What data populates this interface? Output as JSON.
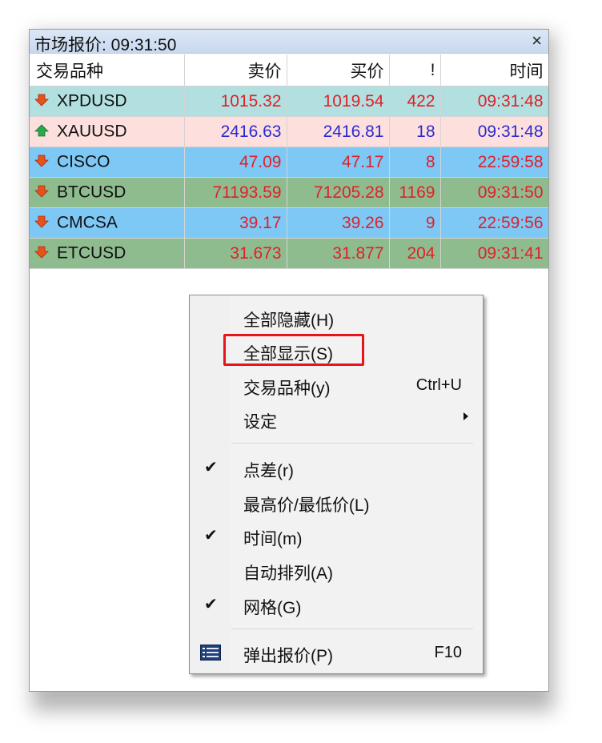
{
  "window": {
    "title": "市场报价: 09:31:50",
    "close_glyph": "×"
  },
  "table": {
    "headers": [
      "交易品种",
      "卖价",
      "买价",
      "!",
      "时间"
    ],
    "rows": [
      {
        "symbol": "XPDUSD",
        "bid": "1015.32",
        "ask": "1019.54",
        "spread": "422",
        "time": "09:31:48",
        "direction": "down",
        "row_color": "#b2dfdf",
        "value_color": "red"
      },
      {
        "symbol": "XAUUSD",
        "bid": "2416.63",
        "ask": "2416.81",
        "spread": "18",
        "time": "09:31:48",
        "direction": "up",
        "row_color": "#fde0de",
        "value_color": "blue"
      },
      {
        "symbol": "CISCO",
        "bid": "47.09",
        "ask": "47.17",
        "spread": "8",
        "time": "22:59:58",
        "direction": "down",
        "row_color": "#7ec8f5",
        "value_color": "red"
      },
      {
        "symbol": "BTCUSD",
        "bid": "71193.59",
        "ask": "71205.28",
        "spread": "1169",
        "time": "09:31:50",
        "direction": "down",
        "row_color": "#8fbc8f",
        "value_color": "red"
      },
      {
        "symbol": "CMCSA",
        "bid": "39.17",
        "ask": "39.26",
        "spread": "9",
        "time": "22:59:56",
        "direction": "down",
        "row_color": "#7ec8f5",
        "value_color": "red"
      },
      {
        "symbol": "ETCUSD",
        "bid": "31.673",
        "ask": "31.877",
        "spread": "204",
        "time": "09:31:41",
        "direction": "down",
        "row_color": "#8fbc8f",
        "value_color": "red"
      }
    ]
  },
  "context_menu": {
    "items": [
      {
        "label": "全部隐藏(H)",
        "shortcut": "",
        "checked": false,
        "submenu": false
      },
      {
        "label": "全部显示(S)",
        "shortcut": "",
        "checked": false,
        "submenu": false,
        "highlighted": true
      },
      {
        "label": "交易品种(y)",
        "shortcut": "Ctrl+U",
        "checked": false,
        "submenu": false
      },
      {
        "label": "设定",
        "shortcut": "",
        "checked": false,
        "submenu": true
      },
      {
        "label": "点差(r)",
        "shortcut": "",
        "checked": true,
        "submenu": false
      },
      {
        "label": "最高价/最低价(L)",
        "shortcut": "",
        "checked": false,
        "submenu": false
      },
      {
        "label": "时间(m)",
        "shortcut": "",
        "checked": true,
        "submenu": false
      },
      {
        "label": "自动排列(A)",
        "shortcut": "",
        "checked": false,
        "submenu": false
      },
      {
        "label": "网格(G)",
        "shortcut": "",
        "checked": true,
        "submenu": false
      },
      {
        "label": "弹出报价(P)",
        "shortcut": "F10",
        "checked": false,
        "submenu": false,
        "icon": "popup-quotes-icon"
      }
    ],
    "check_glyph": "✔"
  },
  "colors": {
    "price_down": "#e0202a",
    "price_up": "#2a2ad0",
    "arrow_down": "#e8501c",
    "arrow_up": "#2aa84a",
    "highlight_box": "#e8141c"
  }
}
